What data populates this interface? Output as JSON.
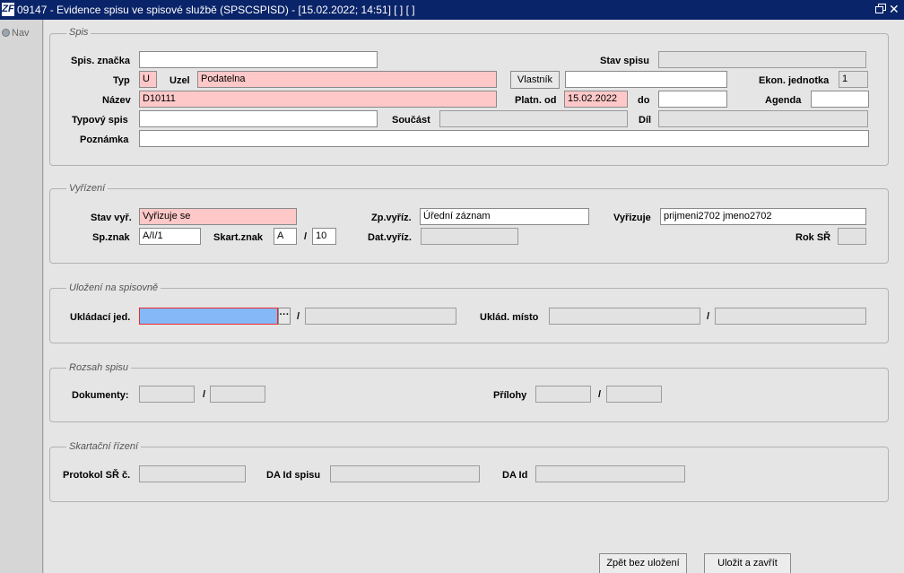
{
  "window": {
    "title": "09147 - Evidence spisu ve spisové službě (SPSCSPISD) - [15.02.2022; 14:51] [ ] [ ]",
    "logo_text": "ZF",
    "close_glyph": "✕"
  },
  "nav": {
    "label": "Nav"
  },
  "spis": {
    "legend": "Spis",
    "labels": {
      "spis_znacka": "Spis. značka",
      "stav_spisu": "Stav spisu",
      "typ": "Typ",
      "uzel": "Uzel",
      "ekon_jednotka": "Ekon. jednotka",
      "nazev": "Název",
      "platn_od": "Platn. od",
      "do": "do",
      "agenda": "Agenda",
      "typovy_spis": "Typový spis",
      "soucast": "Součást",
      "dil": "Díl",
      "poznamka": "Poznámka"
    },
    "values": {
      "spis_znacka": "",
      "stav_spisu": "",
      "typ": "U",
      "uzel": "Podatelna",
      "vlastnik": "",
      "ekon_jednotka": "1",
      "nazev": "D10111",
      "platn_od": "15.02.2022",
      "do": "",
      "agenda": "",
      "typovy_spis": "",
      "soucast": "",
      "dil": "",
      "poznamka": ""
    },
    "vlastnik_button": "Vlastník"
  },
  "vyrizeni": {
    "legend": "Vyřízení",
    "labels": {
      "stav_vyr": "Stav vyř.",
      "zp_vyriz": "Zp.vyříz.",
      "vyrizuje": "Vyřizuje",
      "sp_znak": "Sp.znak",
      "skart_znak": "Skart.znak",
      "slash": "/",
      "dat_vyriz": "Dat.vyříz.",
      "rok_sr": "Rok SŘ"
    },
    "values": {
      "stav_vyr": "Vyřizuje se",
      "zp_vyriz": "Úřední záznam",
      "vyrizuje": "prijmeni2702 jmeno2702",
      "sp_znak": "A/I/1",
      "skart_znak": "A",
      "skart_lhuta": "10",
      "dat_vyriz": "",
      "rok_sr": ""
    }
  },
  "ulozeni": {
    "legend": "Uložení na spisovně",
    "labels": {
      "ukladaci_jed": "Ukládací jed.",
      "uklad_misto": "Uklád. místo",
      "slash": "/"
    },
    "values": {
      "ukladaci_jed": "",
      "ukladaci_jed_2": "",
      "uklad_misto": "",
      "uklad_misto_2": ""
    },
    "lookup_button": "···"
  },
  "rozsah": {
    "legend": "Rozsah spisu",
    "labels": {
      "dokumenty": "Dokumenty:",
      "prilohy": "Přílohy",
      "slash": "/"
    },
    "values": {
      "dokumenty_1": "",
      "dokumenty_2": "",
      "prilohy_1": "",
      "prilohy_2": ""
    }
  },
  "skartace": {
    "legend": "Skartační řízení",
    "labels": {
      "protokol": "Protokol SŘ č.",
      "da_id_spisu": "DA Id spisu",
      "da_id": "DA Id"
    },
    "values": {
      "protokol": "",
      "da_id_spisu": "",
      "da_id": ""
    }
  },
  "buttons": {
    "zpet": "Zpět bez uložení",
    "ulozit": "Uložit a zavřít"
  },
  "colors": {
    "title_bar": "#0a246a",
    "required_field": "#ffc8c8",
    "focused_field": "#84b8f6",
    "focused_border": "#ee2a2a",
    "readonly_field": "#e2e2e2",
    "panel": "#e5e5e5"
  }
}
